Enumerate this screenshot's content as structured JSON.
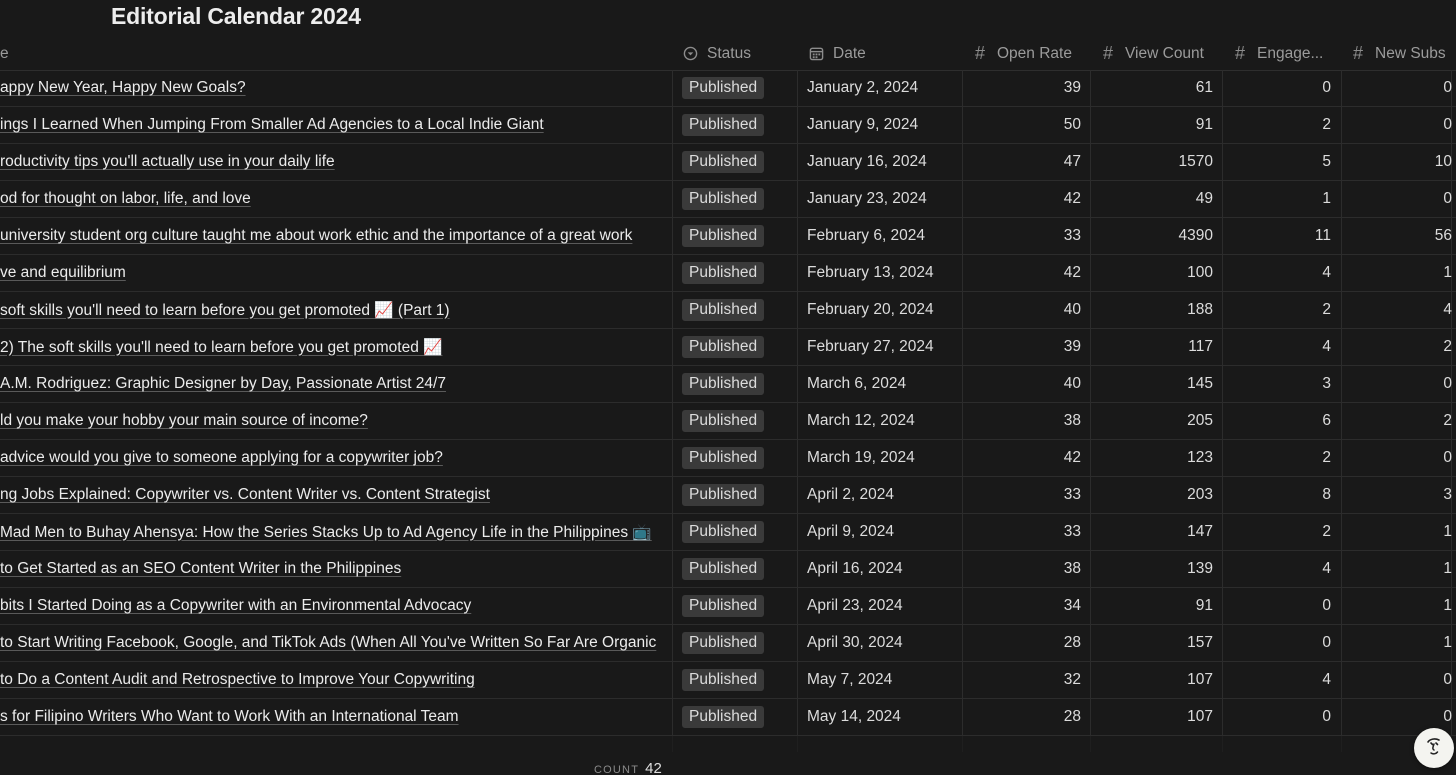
{
  "page_title": "Editorial Calendar 2024",
  "columns": {
    "name_partial": "e",
    "status": "Status",
    "date": "Date",
    "open_rate": "Open Rate",
    "view_count": "View Count",
    "engagement": "Engage...",
    "new_subs": "New Subs"
  },
  "icons": {
    "status": "status-select-icon",
    "date": "calendar-icon",
    "number": "hash-icon",
    "help": "help-face-icon"
  },
  "rows": [
    {
      "name": "appy New Year, Happy New Goals?",
      "status": "Published",
      "date": "January 2, 2024",
      "open_rate": "39",
      "view_count": "61",
      "engagement": "0",
      "new_subs": "0"
    },
    {
      "name": "ings I Learned When Jumping From Smaller Ad Agencies to a Local Indie Giant",
      "status": "Published",
      "date": "January 9, 2024",
      "open_rate": "50",
      "view_count": "91",
      "engagement": "2",
      "new_subs": "0"
    },
    {
      "name": "roductivity tips you'll actually use in your daily life",
      "status": "Published",
      "date": "January 16, 2024",
      "open_rate": "47",
      "view_count": "1570",
      "engagement": "5",
      "new_subs": "10"
    },
    {
      "name": "od for thought on labor, life, and love",
      "status": "Published",
      "date": "January 23, 2024",
      "open_rate": "42",
      "view_count": "49",
      "engagement": "1",
      "new_subs": "0"
    },
    {
      "name": "university student org culture taught me about work ethic and the importance of a great work",
      "status": "Published",
      "date": "February 6, 2024",
      "open_rate": "33",
      "view_count": "4390",
      "engagement": "11",
      "new_subs": "56"
    },
    {
      "name": "ve and equilibrium",
      "status": "Published",
      "date": "February 13, 2024",
      "open_rate": "42",
      "view_count": "100",
      "engagement": "4",
      "new_subs": "1"
    },
    {
      "name": "soft skills you'll need to learn before you get promoted 📈 (Part 1)",
      "status": "Published",
      "date": "February 20, 2024",
      "open_rate": "40",
      "view_count": "188",
      "engagement": "2",
      "new_subs": "4"
    },
    {
      "name": " 2) The soft skills you'll need to learn before you get promoted 📈",
      "status": "Published",
      "date": "February 27, 2024",
      "open_rate": "39",
      "view_count": "117",
      "engagement": "4",
      "new_subs": "2"
    },
    {
      "name": " A.M. Rodriguez: Graphic Designer by Day, Passionate Artist 24/7",
      "status": "Published",
      "date": "March 6, 2024",
      "open_rate": "40",
      "view_count": "145",
      "engagement": "3",
      "new_subs": "0"
    },
    {
      "name": "ld you make your hobby your main source of income?",
      "status": "Published",
      "date": "March 12, 2024",
      "open_rate": "38",
      "view_count": "205",
      "engagement": "6",
      "new_subs": "2"
    },
    {
      "name": " advice would you give to someone applying for a copywriter job?",
      "status": "Published",
      "date": "March 19, 2024",
      "open_rate": "42",
      "view_count": "123",
      "engagement": "2",
      "new_subs": "0"
    },
    {
      "name": "ng Jobs Explained: Copywriter vs. Content Writer vs. Content Strategist",
      "status": "Published",
      "date": "April 2, 2024",
      "open_rate": "33",
      "view_count": "203",
      "engagement": "8",
      "new_subs": "3"
    },
    {
      "name": " Mad Men to Buhay Ahensya: How the Series Stacks Up to Ad Agency Life in the Philippines 📺",
      "status": "Published",
      "date": "April 9, 2024",
      "open_rate": "33",
      "view_count": "147",
      "engagement": "2",
      "new_subs": "1"
    },
    {
      "name": "to Get Started as an SEO Content Writer in the Philippines",
      "status": "Published",
      "date": "April 16, 2024",
      "open_rate": "38",
      "view_count": "139",
      "engagement": "4",
      "new_subs": "1"
    },
    {
      "name": "bits I Started Doing as a Copywriter with an Environmental Advocacy",
      "status": "Published",
      "date": "April 23, 2024",
      "open_rate": "34",
      "view_count": "91",
      "engagement": "0",
      "new_subs": "1"
    },
    {
      "name": "to Start Writing Facebook, Google, and TikTok Ads (When All You've Written So Far Are Organic",
      "status": "Published",
      "date": "April 30, 2024",
      "open_rate": "28",
      "view_count": "157",
      "engagement": "0",
      "new_subs": "1"
    },
    {
      "name": "to Do a Content Audit and Retrospective to Improve Your Copywriting",
      "status": "Published",
      "date": "May 7, 2024",
      "open_rate": "32",
      "view_count": "107",
      "engagement": "4",
      "new_subs": "0"
    },
    {
      "name": "s for Filipino Writers Who Want to Work With an International Team",
      "status": "Published",
      "date": "May 14, 2024",
      "open_rate": "28",
      "view_count": "107",
      "engagement": "0",
      "new_subs": "0"
    }
  ],
  "footer": {
    "count_label": "COUNT",
    "count_value": "42"
  }
}
